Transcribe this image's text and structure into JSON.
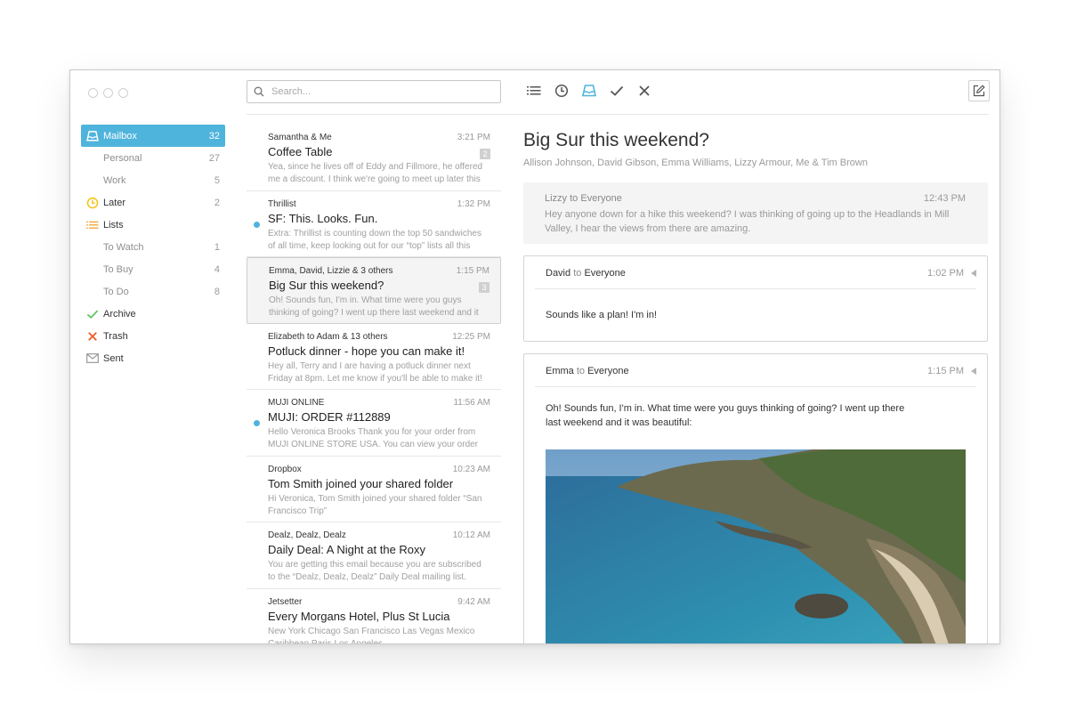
{
  "search": {
    "placeholder": "Search..."
  },
  "sidebar": {
    "items": [
      {
        "label": "Mailbox",
        "count": "32"
      },
      {
        "label": "Personal",
        "count": "27"
      },
      {
        "label": "Work",
        "count": "5"
      },
      {
        "label": "Later",
        "count": "2"
      },
      {
        "label": "Lists",
        "count": ""
      },
      {
        "label": "To Watch",
        "count": "1"
      },
      {
        "label": "To Buy",
        "count": "4"
      },
      {
        "label": "To Do",
        "count": "8"
      },
      {
        "label": "Archive",
        "count": ""
      },
      {
        "label": "Trash",
        "count": ""
      },
      {
        "label": "Sent",
        "count": ""
      }
    ]
  },
  "messages": [
    {
      "from": "Samantha & Me",
      "time": "3:21 PM",
      "subject": "Coffee Table",
      "preview": "Yea, since he lives off of Eddy and Fillmore, he offered me a discount. I think we're going to meet up later this",
      "badge": "2"
    },
    {
      "from": "Thrillist",
      "time": "1:32 PM",
      "subject": "SF: This. Looks. Fun.",
      "preview": "Extra: Thrillist is counting down the top 50 sandwiches of all time, keep looking out for our “top” lists all this",
      "badge": ""
    },
    {
      "from": "Emma, David, Lizzie & 3 others",
      "time": "1:15 PM",
      "subject": "Big Sur this weekend?",
      "preview": "Oh! Sounds fun, I'm in. What time were you guys thinking of going? I went up there last weekend and it",
      "badge": "3"
    },
    {
      "from": "Elizabeth to Adam & 13 others",
      "time": "12:25 PM",
      "subject": "Potluck dinner - hope you can make it!",
      "preview": "Hey all, Terry and I are having a potluck dinner next Friday at 8pm. Let me know if you'll be able to make it!",
      "badge": ""
    },
    {
      "from": "MUJI ONLINE",
      "time": "11:56 AM",
      "subject": "MUJI: ORDER #112889",
      "preview": "Hello Veronica Brooks Thank you for your order from MUJI ONLINE STORE USA. You can view your order",
      "badge": ""
    },
    {
      "from": "Dropbox",
      "time": "10:23 AM",
      "subject": "Tom Smith joined your shared folder",
      "preview": "Hi Veronica, Tom Smith joined your shared folder “San Francisco Trip”",
      "badge": ""
    },
    {
      "from": "Dealz, Dealz, Dealz",
      "time": "10:12 AM",
      "subject": "Daily Deal: A Night at the Roxy",
      "preview": "You are getting this email because you are subscribed to the “Dealz, Dealz, Dealz” Daily Deal mailing list.",
      "badge": ""
    },
    {
      "from": "Jetsetter",
      "time": "9:42 AM",
      "subject": "Every Morgans Hotel, Plus St Lucia",
      "preview": "New York Chicago San Francisco Las Vegas Mexico Caribbean Paris Los Angeles",
      "badge": ""
    }
  ],
  "thread": {
    "title": "Big Sur this weekend?",
    "participants": "Allison Johnson, David Gibson, Emma Williams, Lizzy Armour, Me & Tim Brown",
    "to_word": "to",
    "messages": [
      {
        "sender": "Lizzy",
        "recipient": "Everyone",
        "time": "12:43 PM",
        "body": "Hey anyone down for a hike this weekend? I was thinking of going up to the Headlands in Mill Valley, I hear the views from there are amazing."
      },
      {
        "sender": "David",
        "recipient": "Everyone",
        "time": "1:02 PM",
        "body": "Sounds like a plan! I'm in!"
      },
      {
        "sender": "Emma",
        "recipient": "Everyone",
        "time": "1:15 PM",
        "body": "Oh! Sounds fun, I'm in. What time were you guys thinking of going? I went up there last weekend and it was beautiful:"
      }
    ]
  },
  "colors": {
    "accent": "#4fb4dc",
    "later": "#f5c10a",
    "lists": "#f0a030",
    "archive": "#5cc45c",
    "trash": "#ee5a24"
  },
  "icons": {
    "sidebar": [
      "mailbox-tray-icon",
      "clock-icon",
      "list-icon",
      "checkmark-icon",
      "x-icon",
      "envelope-icon"
    ],
    "toolbar": [
      "list-icon",
      "clock-icon",
      "mailbox-tray-icon",
      "checkmark-icon",
      "x-icon",
      "compose-icon"
    ]
  }
}
